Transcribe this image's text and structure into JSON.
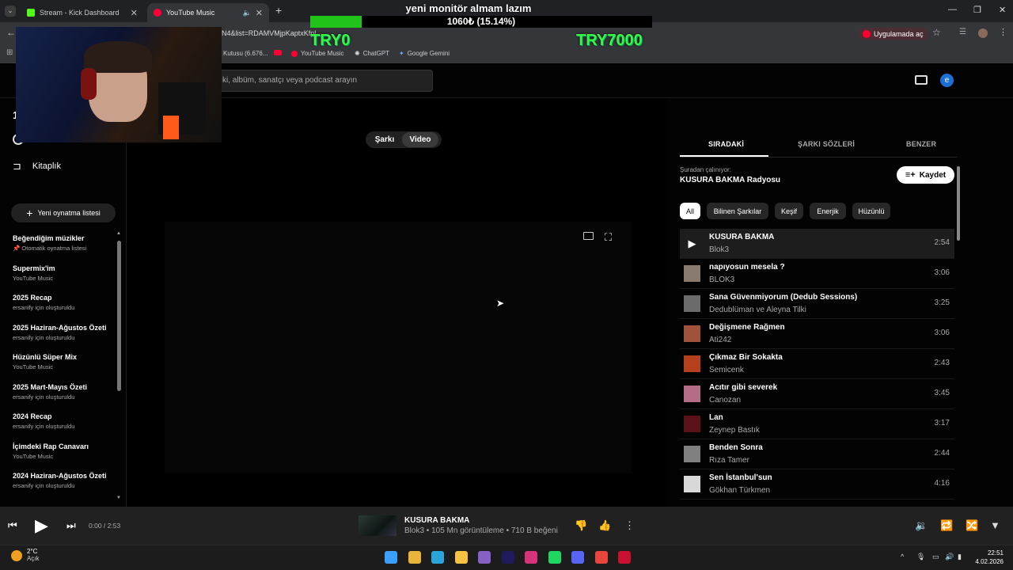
{
  "browser": {
    "tabs": [
      {
        "label": "Stream - Kick Dashboard"
      },
      {
        "label": "YouTube Music"
      }
    ],
    "url": "N4&list=RDAMVMjpKaptxKfpl",
    "open_in_app_label": "Uygulamada aç",
    "bookmarks": [
      {
        "label": "Kutusu (6.676..."
      },
      {
        "label": "YouTube Music"
      },
      {
        "label": "ChatGPT"
      },
      {
        "label": "Google Gemini"
      }
    ]
  },
  "stream_overlay": {
    "goal_title": "yeni monitör almam lazım",
    "goal_amount": "1060₺ (15.14%)",
    "goal_progress": 0.1514,
    "goal_min": "TRY0",
    "goal_max": "TRY7000"
  },
  "header": {
    "search_placeholder": "ki, albüm, sanatçı veya podcast arayın",
    "avatar_letter": "e"
  },
  "sidebar": {
    "top_letter": "1",
    "library_label": "Kitaplık",
    "new_playlist_label": "Yeni oynatma listesi",
    "playlists": [
      {
        "title": "Beğendiğim müzikler",
        "subtitle": "📌 Otomatik oynatma listesi"
      },
      {
        "title": "Supermix'im",
        "subtitle": "YouTube Music"
      },
      {
        "title": "2025 Recap",
        "subtitle": "ersanify için oluşturuldu"
      },
      {
        "title": "2025 Haziran-Ağustos Özeti",
        "subtitle": "ersanify için oluşturuldu"
      },
      {
        "title": "Hüzünlü Süper Mix",
        "subtitle": "YouTube Music"
      },
      {
        "title": "2025 Mart-Mayıs Özeti",
        "subtitle": "ersanify için oluşturuldu"
      },
      {
        "title": "2024 Recap",
        "subtitle": "ersanify için oluşturuldu"
      },
      {
        "title": "İçimdeki Rap Canavarı",
        "subtitle": "YouTube Music"
      },
      {
        "title": "2024 Haziran-Ağustos Özeti",
        "subtitle": "ersanify için oluşturuldu"
      }
    ]
  },
  "main": {
    "toggle_song": "Şarkı",
    "toggle_video": "Video"
  },
  "right_panel": {
    "tabs": [
      {
        "label": "SIRADAKİ"
      },
      {
        "label": "ŞARKI SÖZLERİ"
      },
      {
        "label": "BENZER"
      }
    ],
    "playing_from_label": "Şuradan çalınıyor:",
    "playlist_name": "KUSURA BAKMA Radyosu",
    "save_label": "Kaydet",
    "chips": [
      {
        "label": "All"
      },
      {
        "label": "Bilinen Şarkılar"
      },
      {
        "label": "Keşif"
      },
      {
        "label": "Enerjik"
      },
      {
        "label": "Hüzünlü"
      }
    ],
    "queue": [
      {
        "title": "KUSURA BAKMA",
        "artist": "Blok3",
        "duration": "2:54",
        "thumb": "#333333"
      },
      {
        "title": "napıyosun mesela ?",
        "artist": "BLOK3",
        "duration": "3:06",
        "thumb": "#8a7a6e"
      },
      {
        "title": "Sana Güvenmiyorum (Dedub Sessions)",
        "artist": "Dedublüman ve Aleyna Tilki",
        "duration": "3:25",
        "thumb": "#6b6b6b"
      },
      {
        "title": "Değişmene Rağmen",
        "artist": "Ati242",
        "duration": "3:06",
        "thumb": "#a0523a"
      },
      {
        "title": "Çıkmaz Bir Sokakta",
        "artist": "Semicenk",
        "duration": "2:43",
        "thumb": "#b5401e"
      },
      {
        "title": "Acıtır gibi severek",
        "artist": "Canozan",
        "duration": "3:45",
        "thumb": "#b56c86"
      },
      {
        "title": "Lan",
        "artist": "Zeynep Bastık",
        "duration": "3:17",
        "thumb": "#5a1218"
      },
      {
        "title": "Benden Sonra",
        "artist": "Rıza Tamer",
        "duration": "2:44",
        "thumb": "#808080"
      },
      {
        "title": "Sen İstanbul'sun",
        "artist": "Gökhan Türkmen",
        "duration": "4:16",
        "thumb": "#d8d8d8"
      }
    ]
  },
  "player": {
    "time": "0:00 / 2:53",
    "title": "KUSURA BAKMA",
    "subtitle": "Blok3 • 105 Mn görüntüleme • 710 B beğeni"
  },
  "taskbar": {
    "temperature": "2°C",
    "weather": "Açık",
    "time": "22:51",
    "date": "4.02.2026",
    "apps": [
      {
        "icon": "windows-start-icon",
        "color": "#3aa0ff"
      },
      {
        "icon": "store-icon",
        "color": "#e8b43a"
      },
      {
        "icon": "edge-icon",
        "color": "#2aa5d8"
      },
      {
        "icon": "explorer-icon",
        "color": "#f5c242"
      },
      {
        "icon": "visual-studio-icon",
        "color": "#8661c5"
      },
      {
        "icon": "after-effects-icon",
        "color": "#1f1a5a"
      },
      {
        "icon": "instagram-icon",
        "color": "#d6337a"
      },
      {
        "icon": "spotify-icon",
        "color": "#1ed760"
      },
      {
        "icon": "discord-icon",
        "color": "#5865f2"
      },
      {
        "icon": "chrome-icon",
        "color": "#e8453c"
      },
      {
        "icon": "app-red-icon",
        "color": "#c9102e"
      }
    ]
  }
}
